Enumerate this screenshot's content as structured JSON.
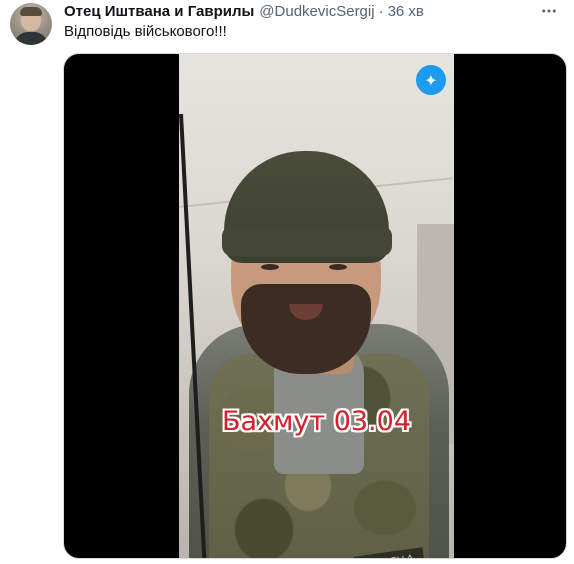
{
  "tweet": {
    "author_name": "Отец Иштвана и Гаврилы",
    "handle": "@DudkevicSergij",
    "separator": "·",
    "time": "36 хв",
    "text": "Відповідь військового!!!",
    "more_icon": "more-horizontal-icon"
  },
  "media": {
    "video_caption": "Бахмут 03.04",
    "badge_icon": "sparkle-icon",
    "badge_glyph": "✦",
    "patch_text": "UMBRELLA"
  },
  "colors": {
    "accent": "#1d9bf0",
    "caption_red": "#d4202c",
    "secondary_text": "#536471"
  }
}
